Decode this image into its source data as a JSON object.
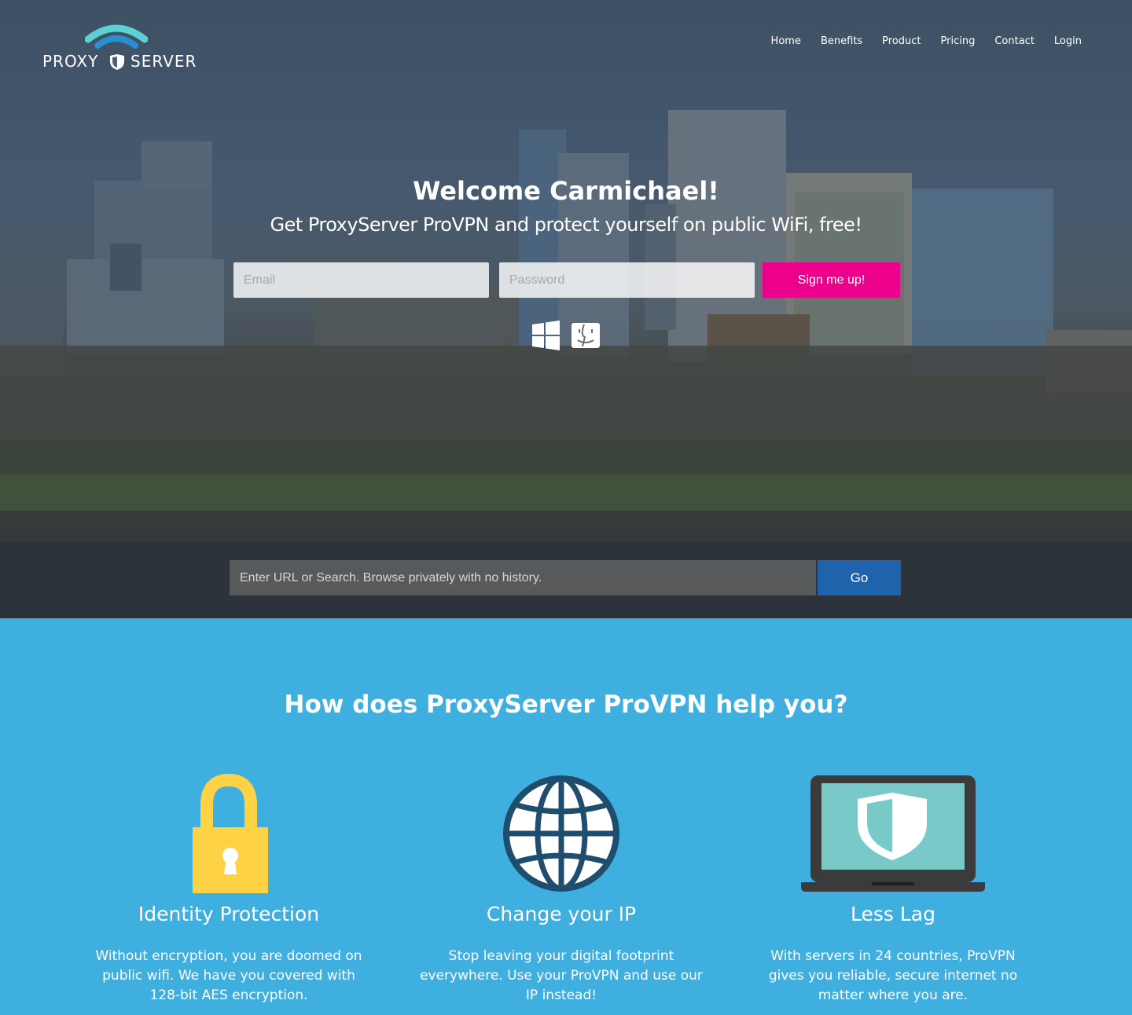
{
  "brand": {
    "name_left": "PROXY",
    "name_right": "SERVER",
    "colors": {
      "wave_outer": "#5fcfd6",
      "wave_inner": "#2a8fd1",
      "accent_pink": "#ec008c",
      "go_blue": "#1f63ac",
      "section_blue": "#3fafdf"
    }
  },
  "nav": {
    "items": [
      "Home",
      "Benefits",
      "Product",
      "Pricing",
      "Contact",
      "Login"
    ]
  },
  "hero": {
    "welcome": "Welcome Carmichael!",
    "tagline": "Get ProxyServer ProVPN and protect yourself on public WiFi, free!",
    "email_placeholder": "Email",
    "password_placeholder": "Password",
    "signup_label": "Sign me up!",
    "os_icons": [
      "windows-icon",
      "mac-finder-icon"
    ],
    "url_placeholder": "Enter URL or Search. Browse privately with no history.",
    "go_label": "Go"
  },
  "features": {
    "title": "How does ProxyServer ProVPN help you?",
    "items": [
      {
        "icon": "padlock-icon",
        "title": "Identity Protection",
        "text": "Without encryption, you are doomed on public wifi. We have you covered with 128-bit AES encryption."
      },
      {
        "icon": "globe-icon",
        "title": "Change your IP",
        "text": "Stop leaving your digital footprint everywhere. Use your ProVPN and use our IP instead!"
      },
      {
        "icon": "laptop-shield-icon",
        "title": "Less Lag",
        "text": "With servers in 24 countries, ProVPN gives you reliable, secure internet no matter where you are."
      }
    ]
  }
}
